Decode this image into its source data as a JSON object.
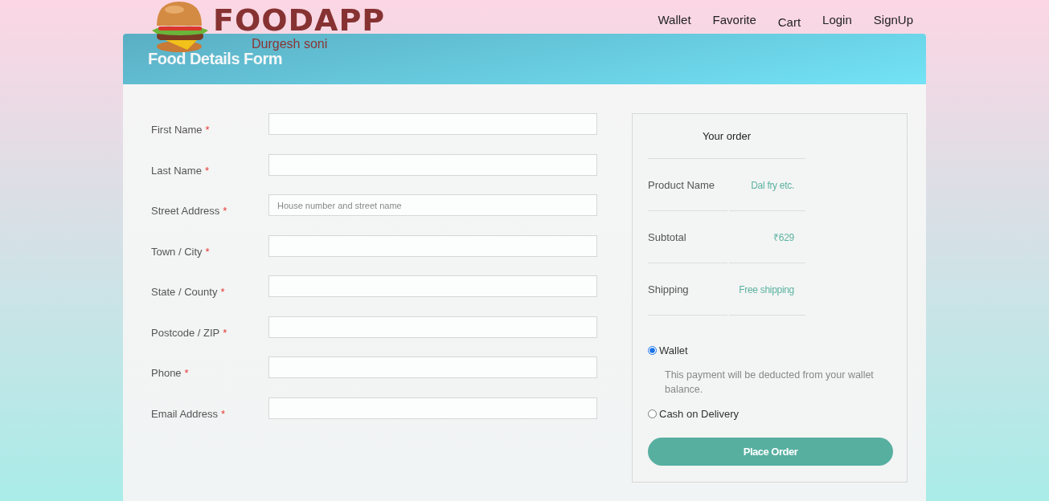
{
  "brand": {
    "name": "FOODAPP",
    "author": "Durgesh soni"
  },
  "nav": [
    "Wallet",
    "Favorite",
    "Cart",
    "Login",
    "SignUp"
  ],
  "form": {
    "title": "Food Details Form",
    "fields": [
      {
        "label": "First Name",
        "required_mark": "*"
      },
      {
        "label": "Last Name",
        "required_mark": "*"
      },
      {
        "label": "Street Address",
        "required_mark": "*",
        "placeholder": "House number and street name"
      },
      {
        "label": "Town / City",
        "required_mark": "*"
      },
      {
        "label": "State / County",
        "required_mark": "*"
      },
      {
        "label": "Postcode / ZIP",
        "required_mark": "*"
      },
      {
        "label": "Phone",
        "required_mark": "*"
      },
      {
        "label": "Email Address",
        "required_mark": "*"
      }
    ]
  },
  "order": {
    "title": "Your order",
    "rows": [
      {
        "label": "Product Name",
        "value": "Dal fry etc."
      },
      {
        "label": "Subtotal",
        "value": "₹629"
      },
      {
        "label": "Shipping",
        "value": "Free shipping"
      }
    ],
    "payment": [
      {
        "label": "Wallet",
        "selected": true,
        "note": "This payment will be deducted from your wallet balance."
      },
      {
        "label": "Cash on Delivery",
        "selected": false
      }
    ],
    "button": "Place Order"
  }
}
